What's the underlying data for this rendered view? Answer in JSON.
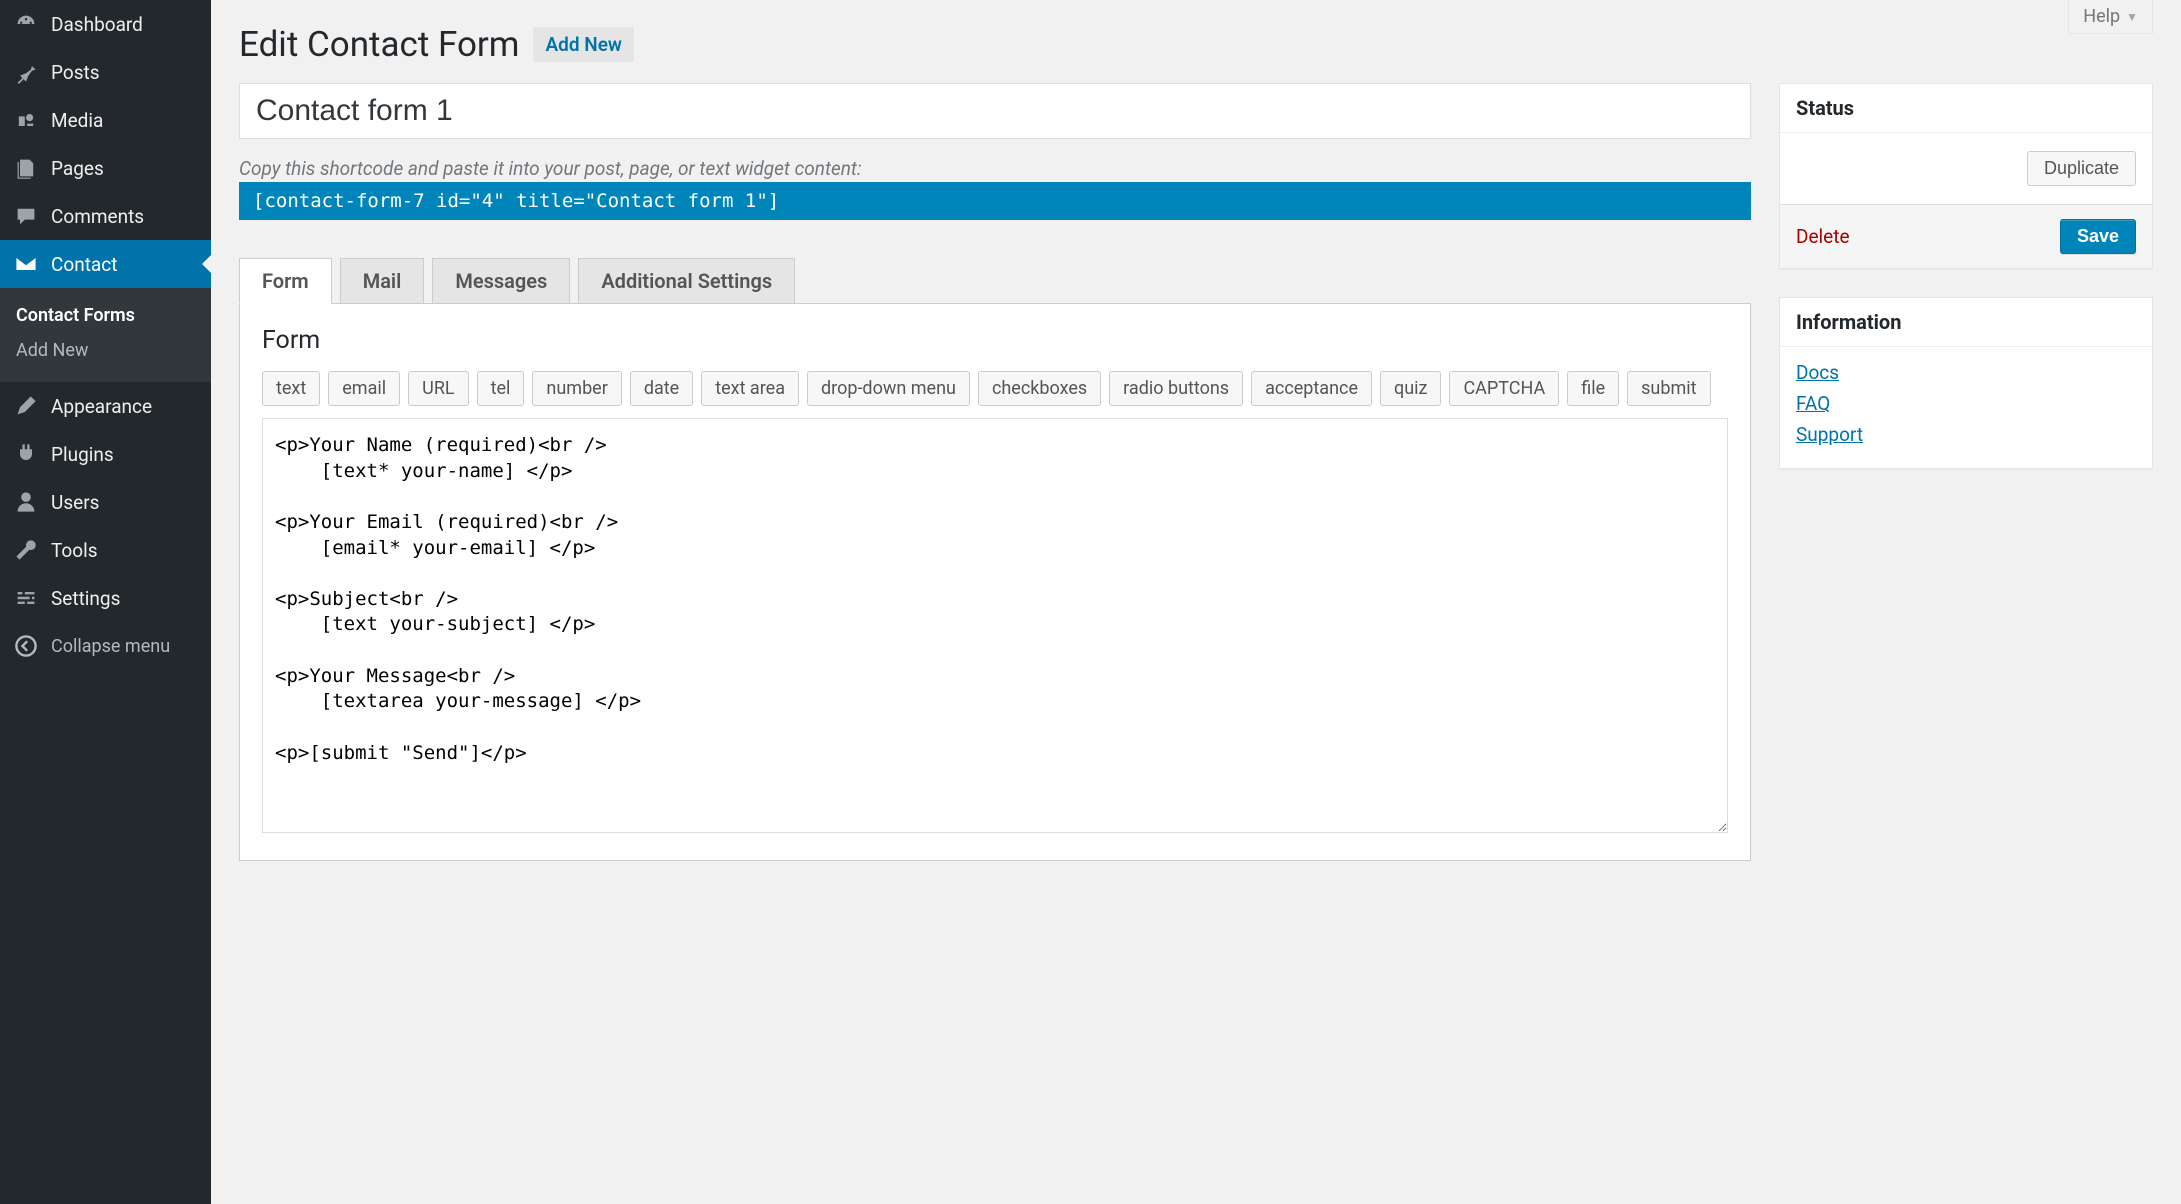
{
  "help": "Help",
  "page_title": "Edit Contact Form",
  "add_new_button": "Add New",
  "form_title": "Contact form 1",
  "shortcode_hint": "Copy this shortcode and paste it into your post, page, or text widget content:",
  "shortcode": "[contact-form-7 id=\"4\" title=\"Contact form 1\"]",
  "sidebar": {
    "items": [
      {
        "label": "Dashboard"
      },
      {
        "label": "Posts"
      },
      {
        "label": "Media"
      },
      {
        "label": "Pages"
      },
      {
        "label": "Comments"
      },
      {
        "label": "Contact"
      },
      {
        "label": "Appearance"
      },
      {
        "label": "Plugins"
      },
      {
        "label": "Users"
      },
      {
        "label": "Tools"
      },
      {
        "label": "Settings"
      }
    ],
    "sub": [
      {
        "label": "Contact Forms"
      },
      {
        "label": "Add New"
      }
    ],
    "collapse": "Collapse menu"
  },
  "tabs": [
    {
      "label": "Form"
    },
    {
      "label": "Mail"
    },
    {
      "label": "Messages"
    },
    {
      "label": "Additional Settings"
    }
  ],
  "panel_heading": "Form",
  "tag_buttons": [
    "text",
    "email",
    "URL",
    "tel",
    "number",
    "date",
    "text area",
    "drop-down menu",
    "checkboxes",
    "radio buttons",
    "acceptance",
    "quiz",
    "CAPTCHA",
    "file",
    "submit"
  ],
  "form_content": "<p>Your Name (required)<br />\n    [text* your-name] </p>\n\n<p>Your Email (required)<br />\n    [email* your-email] </p>\n\n<p>Subject<br />\n    [text your-subject] </p>\n\n<p>Your Message<br />\n    [textarea your-message] </p>\n\n<p>[submit \"Send\"]</p>",
  "status": {
    "heading": "Status",
    "duplicate": "Duplicate",
    "delete": "Delete",
    "save": "Save"
  },
  "info": {
    "heading": "Information",
    "docs": "Docs",
    "faq": "FAQ",
    "support": "Support"
  }
}
